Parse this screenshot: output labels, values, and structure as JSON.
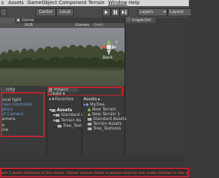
{
  "menu": {
    "items": [
      "s",
      "Assets",
      "GameObject",
      "Component",
      "Terrain",
      "Window",
      "Help"
    ]
  },
  "toolbar": {
    "center": "Center",
    "local": "Local",
    "layers": "Layers",
    "layout": "Layout"
  },
  "scene": {
    "tab_label": "Game",
    "shading": "RGB",
    "gizmos": "Gizmos",
    "search": "Q▾All",
    "view_label": "Back",
    "axis_y": "y",
    "axis_x": "x"
  },
  "inspector": {
    "tab_label": "Inspector"
  },
  "hierarchy": {
    "tab_label": "rchy",
    "items": [
      {
        "label": "onal light",
        "color": "#cfcfcf"
      },
      {
        "label": "rson Controller",
        "color": "#6f9bd8"
      },
      {
        "label": "phics",
        "color": "#6f9bd8"
      },
      {
        "label": "st Camera",
        "color": "#6f9bd8"
      },
      {
        "label": "amera",
        "color": "#cfcfcf"
      },
      {
        "label": "e",
        "color": "#cfcfcf"
      },
      {
        "label": "ine",
        "color": "#cfcfcf"
      }
    ]
  },
  "project": {
    "tab_label": "Project",
    "create": "Create ▾",
    "favorites": "Favorites",
    "assets_label": "Assets",
    "tree": [
      "Standard A",
      "Terrain As",
      "Tree_Textu"
    ],
    "breadcrumb": "Assets ▸",
    "files": [
      "MyTree",
      "New Terrain",
      "New Terrain 1",
      "Standard Assets",
      "Terrain Assets",
      "Tree_Textures"
    ]
  },
  "status": {
    "message": "are 2 audio listeners in the scene. Please ensure there is always exactly one audio listener in the scene."
  },
  "colors": {
    "highlight_box": "#c8232d",
    "error_text": "#ff4d3a"
  }
}
